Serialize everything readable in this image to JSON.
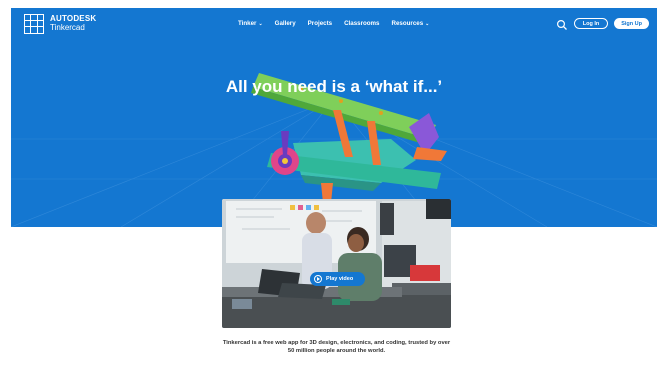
{
  "brand": {
    "line1": "AUTODESK",
    "line2": "Tinkercad",
    "accent": "#1477d1"
  },
  "nav": {
    "items": [
      {
        "label": "Tinker",
        "dropdown": true
      },
      {
        "label": "Gallery",
        "dropdown": false
      },
      {
        "label": "Projects",
        "dropdown": false
      },
      {
        "label": "Classrooms",
        "dropdown": false
      },
      {
        "label": "Resources",
        "dropdown": true
      }
    ],
    "login": "Log In",
    "signup": "Sign Up",
    "search_icon": "search-icon"
  },
  "hero": {
    "title": "All you need is a ‘what if...’",
    "image": "toy-biplane-illustration"
  },
  "video": {
    "play_label": "Play video",
    "scene": "classroom-students-with-laptops"
  },
  "tagline": "Tinkercad is a free web app for 3D design, electronics, and coding, trusted by over 50 million people around the world."
}
